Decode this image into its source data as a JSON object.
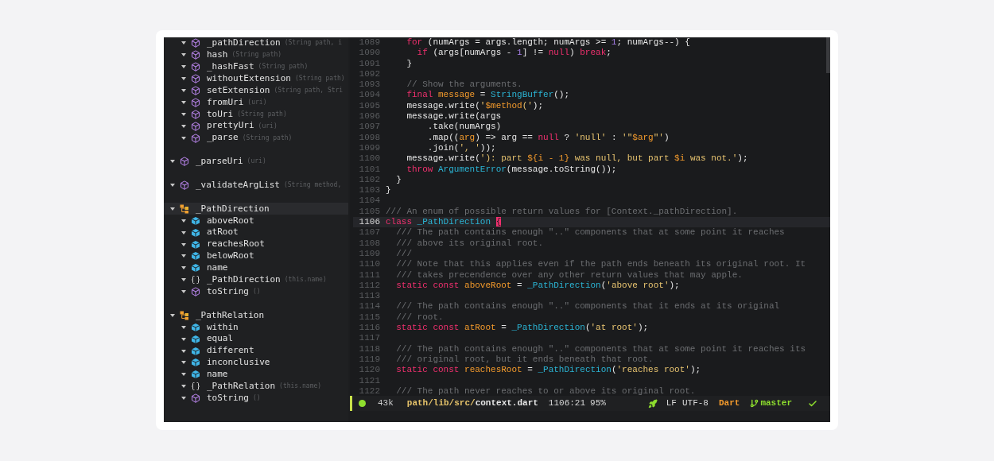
{
  "outline": [
    {
      "children": [
        {
          "kind": "method",
          "label": "_pathDirection",
          "params": "(String path, i",
          "expanded": true,
          "selected": false
        },
        {
          "kind": "method",
          "label": "hash",
          "params": "(String path)",
          "expanded": true,
          "selected": false
        },
        {
          "kind": "method",
          "label": "_hashFast",
          "params": "(String path)",
          "expanded": true,
          "selected": false
        },
        {
          "kind": "method",
          "label": "withoutExtension",
          "params": "(String path)",
          "expanded": true,
          "selected": false
        },
        {
          "kind": "method",
          "label": "setExtension",
          "params": "(String path, Stri",
          "expanded": true,
          "selected": false
        },
        {
          "kind": "method",
          "label": "fromUri",
          "params": "(uri)",
          "expanded": true,
          "selected": false
        },
        {
          "kind": "method",
          "label": "toUri",
          "params": "(String path)",
          "expanded": true,
          "selected": false
        },
        {
          "kind": "method",
          "label": "prettyUri",
          "params": "(uri)",
          "expanded": true,
          "selected": false
        },
        {
          "kind": "method",
          "label": "_parse",
          "params": "(String path)",
          "expanded": true,
          "selected": false
        }
      ]
    },
    {
      "kind": "method",
      "label": "_parseUri",
      "params": "(uri)",
      "expanded": true,
      "selected": false
    },
    {
      "kind": "method",
      "label": "_validateArgList",
      "params": "(String method,",
      "expanded": true,
      "selected": false
    },
    {
      "kind": "class",
      "label": "_PathDirection",
      "expanded": true,
      "selected": true,
      "children": [
        {
          "kind": "field",
          "label": "aboveRoot",
          "expanded": true,
          "selected": false
        },
        {
          "kind": "field",
          "label": "atRoot",
          "expanded": true,
          "selected": false
        },
        {
          "kind": "field",
          "label": "reachesRoot",
          "expanded": true,
          "selected": false
        },
        {
          "kind": "field",
          "label": "belowRoot",
          "expanded": true,
          "selected": false
        },
        {
          "kind": "field",
          "label": "name",
          "expanded": true,
          "selected": false
        },
        {
          "kind": "constructor",
          "label": "_PathDirection",
          "params": "(this.name)",
          "expanded": true,
          "selected": false
        },
        {
          "kind": "method",
          "label": "toString",
          "params": "()",
          "expanded": true,
          "selected": false
        }
      ]
    },
    {
      "kind": "class",
      "label": "_PathRelation",
      "expanded": true,
      "selected": false,
      "children": [
        {
          "kind": "field",
          "label": "within",
          "expanded": true,
          "selected": false
        },
        {
          "kind": "field",
          "label": "equal",
          "expanded": true,
          "selected": false
        },
        {
          "kind": "field",
          "label": "different",
          "expanded": true,
          "selected": false
        },
        {
          "kind": "field",
          "label": "inconclusive",
          "expanded": true,
          "selected": false
        },
        {
          "kind": "field",
          "label": "name",
          "expanded": true,
          "selected": false
        },
        {
          "kind": "constructor",
          "label": "_PathRelation",
          "params": "(this.name)",
          "expanded": true,
          "selected": false
        },
        {
          "kind": "method",
          "label": "toString",
          "params": "()",
          "expanded": true,
          "selected": false
        }
      ]
    }
  ],
  "code_lines": [
    {
      "number": "1089",
      "current": false,
      "tokens": [
        {
          "kind": "keyword",
          "text": "    for"
        },
        {
          "kind": "plain",
          "text": " (numArgs = args.length; numArgs >= "
        },
        {
          "kind": "number",
          "text": "1"
        },
        {
          "kind": "plain",
          "text": "; numArgs--) {"
        }
      ]
    },
    {
      "number": "1090",
      "current": false,
      "tokens": [
        {
          "kind": "keyword",
          "text": "      if"
        },
        {
          "kind": "plain",
          "text": " (args[numArgs - "
        },
        {
          "kind": "number",
          "text": "1"
        },
        {
          "kind": "plain",
          "text": "] != "
        },
        {
          "kind": "keyword",
          "text": "null"
        },
        {
          "kind": "plain",
          "text": ") "
        },
        {
          "kind": "keyword",
          "text": "break"
        },
        {
          "kind": "plain",
          "text": ";"
        }
      ]
    },
    {
      "number": "1091",
      "current": false,
      "tokens": [
        {
          "kind": "plain",
          "text": "    }"
        }
      ]
    },
    {
      "number": "1092",
      "current": false
    },
    {
      "number": "1093",
      "current": false,
      "tokens": [
        {
          "kind": "comment",
          "text": "    // Show the arguments."
        }
      ]
    },
    {
      "number": "1094",
      "current": false,
      "tokens": [
        {
          "kind": "keyword",
          "text": "    final "
        },
        {
          "kind": "declaration",
          "text": "message"
        },
        {
          "kind": "plain",
          "text": " = "
        },
        {
          "kind": "type",
          "text": "StringBuffer"
        },
        {
          "kind": "plain",
          "text": "();"
        }
      ]
    },
    {
      "number": "1095",
      "current": false,
      "tokens": [
        {
          "kind": "plain",
          "text": "    message.write("
        },
        {
          "kind": "string",
          "text": "'"
        },
        {
          "kind": "declaration",
          "text": "$method"
        },
        {
          "kind": "string",
          "text": "('"
        },
        {
          "kind": "plain",
          "text": ");"
        }
      ]
    },
    {
      "number": "1096",
      "current": false,
      "tokens": [
        {
          "kind": "plain",
          "text": "    message.write(args"
        }
      ]
    },
    {
      "number": "1097",
      "current": false,
      "tokens": [
        {
          "kind": "plain",
          "text": "        .take(numArgs)"
        }
      ]
    },
    {
      "number": "1098",
      "current": false,
      "tokens": [
        {
          "kind": "plain",
          "text": "        .map(("
        },
        {
          "kind": "declaration",
          "text": "arg"
        },
        {
          "kind": "plain",
          "text": ") => arg == "
        },
        {
          "kind": "keyword",
          "text": "null"
        },
        {
          "kind": "plain",
          "text": " ? "
        },
        {
          "kind": "string",
          "text": "'null'"
        },
        {
          "kind": "plain",
          "text": " : "
        },
        {
          "kind": "string",
          "text": "'\""
        },
        {
          "kind": "declaration",
          "text": "$arg"
        },
        {
          "kind": "string",
          "text": "\"'"
        },
        {
          "kind": "plain",
          "text": ")"
        }
      ]
    },
    {
      "number": "1099",
      "current": false,
      "tokens": [
        {
          "kind": "plain",
          "text": "        .join("
        },
        {
          "kind": "string",
          "text": "', '"
        },
        {
          "kind": "plain",
          "text": "));"
        }
      ]
    },
    {
      "number": "1100",
      "current": false,
      "tokens": [
        {
          "kind": "plain",
          "text": "    message.write("
        },
        {
          "kind": "string",
          "text": "'): part "
        },
        {
          "kind": "declaration",
          "text": "${i - 1}"
        },
        {
          "kind": "string",
          "text": " was null, but part "
        },
        {
          "kind": "declaration",
          "text": "$i"
        },
        {
          "kind": "string",
          "text": " was not.'"
        },
        {
          "kind": "plain",
          "text": ");"
        }
      ]
    },
    {
      "number": "1101",
      "current": false,
      "tokens": [
        {
          "kind": "keyword",
          "text": "    throw "
        },
        {
          "kind": "type",
          "text": "ArgumentError"
        },
        {
          "kind": "plain",
          "text": "(message.toString());"
        }
      ]
    },
    {
      "number": "1102",
      "current": false,
      "tokens": [
        {
          "kind": "plain",
          "text": "  }"
        }
      ]
    },
    {
      "number": "1103",
      "current": false,
      "tokens": [
        {
          "kind": "plain",
          "text": "}"
        }
      ]
    },
    {
      "number": "1104",
      "current": false
    },
    {
      "number": "1105",
      "current": false,
      "tokens": [
        {
          "kind": "comment",
          "text": "/// An enum of possible return values for [Context._pathDirection]."
        }
      ]
    },
    {
      "number": "1106",
      "current": true,
      "tokens": [
        {
          "kind": "keyword",
          "text": "class "
        },
        {
          "kind": "type",
          "text": "_PathDirection "
        },
        {
          "kind": "cursor",
          "text": "{"
        }
      ]
    },
    {
      "number": "1107",
      "current": false,
      "tokens": [
        {
          "kind": "comment",
          "text": "  /// The path contains enough \"..\" components that at some point it reaches"
        }
      ]
    },
    {
      "number": "1108",
      "current": false,
      "tokens": [
        {
          "kind": "comment",
          "text": "  /// above its original root."
        }
      ]
    },
    {
      "number": "1109",
      "current": false,
      "tokens": [
        {
          "kind": "comment",
          "text": "  ///"
        }
      ]
    },
    {
      "number": "1110",
      "current": false,
      "tokens": [
        {
          "kind": "comment",
          "text": "  /// Note that this applies even if the path ends beneath its original root. It"
        }
      ]
    },
    {
      "number": "1111",
      "current": false,
      "tokens": [
        {
          "kind": "comment",
          "text": "  /// takes precendence over any other return values that may apple."
        }
      ]
    },
    {
      "number": "1112",
      "current": false,
      "tokens": [
        {
          "kind": "keyword",
          "text": "  static const "
        },
        {
          "kind": "declaration",
          "text": "aboveRoot"
        },
        {
          "kind": "plain",
          "text": " = "
        },
        {
          "kind": "type",
          "text": "_PathDirection"
        },
        {
          "kind": "plain",
          "text": "("
        },
        {
          "kind": "string",
          "text": "'above root'"
        },
        {
          "kind": "plain",
          "text": ");"
        }
      ]
    },
    {
      "number": "1113",
      "current": false
    },
    {
      "number": "1114",
      "current": false,
      "tokens": [
        {
          "kind": "comment",
          "text": "  /// The path contains enough \"..\" components that it ends at its original"
        }
      ]
    },
    {
      "number": "1115",
      "current": false,
      "tokens": [
        {
          "kind": "comment",
          "text": "  /// root."
        }
      ]
    },
    {
      "number": "1116",
      "current": false,
      "tokens": [
        {
          "kind": "keyword",
          "text": "  static const "
        },
        {
          "kind": "declaration",
          "text": "atRoot"
        },
        {
          "kind": "plain",
          "text": " = "
        },
        {
          "kind": "type",
          "text": "_PathDirection"
        },
        {
          "kind": "plain",
          "text": "("
        },
        {
          "kind": "string",
          "text": "'at root'"
        },
        {
          "kind": "plain",
          "text": ");"
        }
      ]
    },
    {
      "number": "1117",
      "current": false
    },
    {
      "number": "1118",
      "current": false,
      "tokens": [
        {
          "kind": "comment",
          "text": "  /// The path contains enough \"..\" components that at some point it reaches its"
        }
      ]
    },
    {
      "number": "1119",
      "current": false,
      "tokens": [
        {
          "kind": "comment",
          "text": "  /// original root, but it ends beneath that root."
        }
      ]
    },
    {
      "number": "1120",
      "current": false,
      "tokens": [
        {
          "kind": "keyword",
          "text": "  static const "
        },
        {
          "kind": "declaration",
          "text": "reachesRoot"
        },
        {
          "kind": "plain",
          "text": " = "
        },
        {
          "kind": "type",
          "text": "_PathDirection"
        },
        {
          "kind": "plain",
          "text": "("
        },
        {
          "kind": "string",
          "text": "'reaches root'"
        },
        {
          "kind": "plain",
          "text": ");"
        }
      ]
    },
    {
      "number": "1121",
      "current": false
    },
    {
      "number": "1122",
      "current": false,
      "tokens": [
        {
          "kind": "comment",
          "text": "  /// The path never reaches to or above its original root."
        }
      ]
    }
  ],
  "status_bar": {
    "size": "43k",
    "path_dir": "path/lib/src/",
    "file": "context.dart",
    "position": "1106:21",
    "percent": "95%",
    "line_ending": "LF",
    "encoding": "UTF-8",
    "language": "Dart",
    "branch": "master"
  }
}
